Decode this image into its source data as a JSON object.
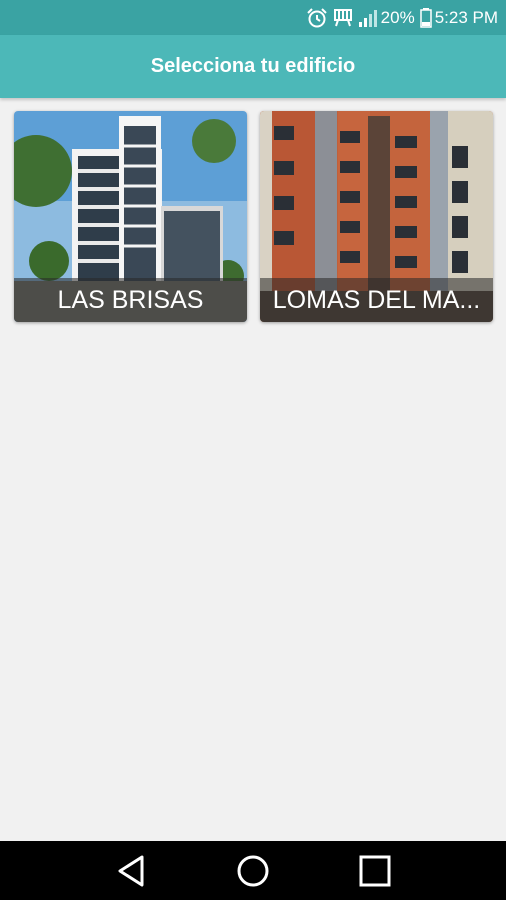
{
  "status_bar": {
    "battery_percent": "20%",
    "time": "5:23 PM",
    "icons": [
      "alarm-icon",
      "signal-icon",
      "battery-icon"
    ],
    "background": "#3aa3a3"
  },
  "app_bar": {
    "title": "Selecciona tu edificio",
    "background": "#4cb8b8"
  },
  "buildings": [
    {
      "name": "LAS BRISAS"
    },
    {
      "name": "LOMAS DEL MA..."
    }
  ],
  "nav_bar": {
    "buttons": [
      "back-icon",
      "home-icon",
      "recents-icon"
    ]
  }
}
